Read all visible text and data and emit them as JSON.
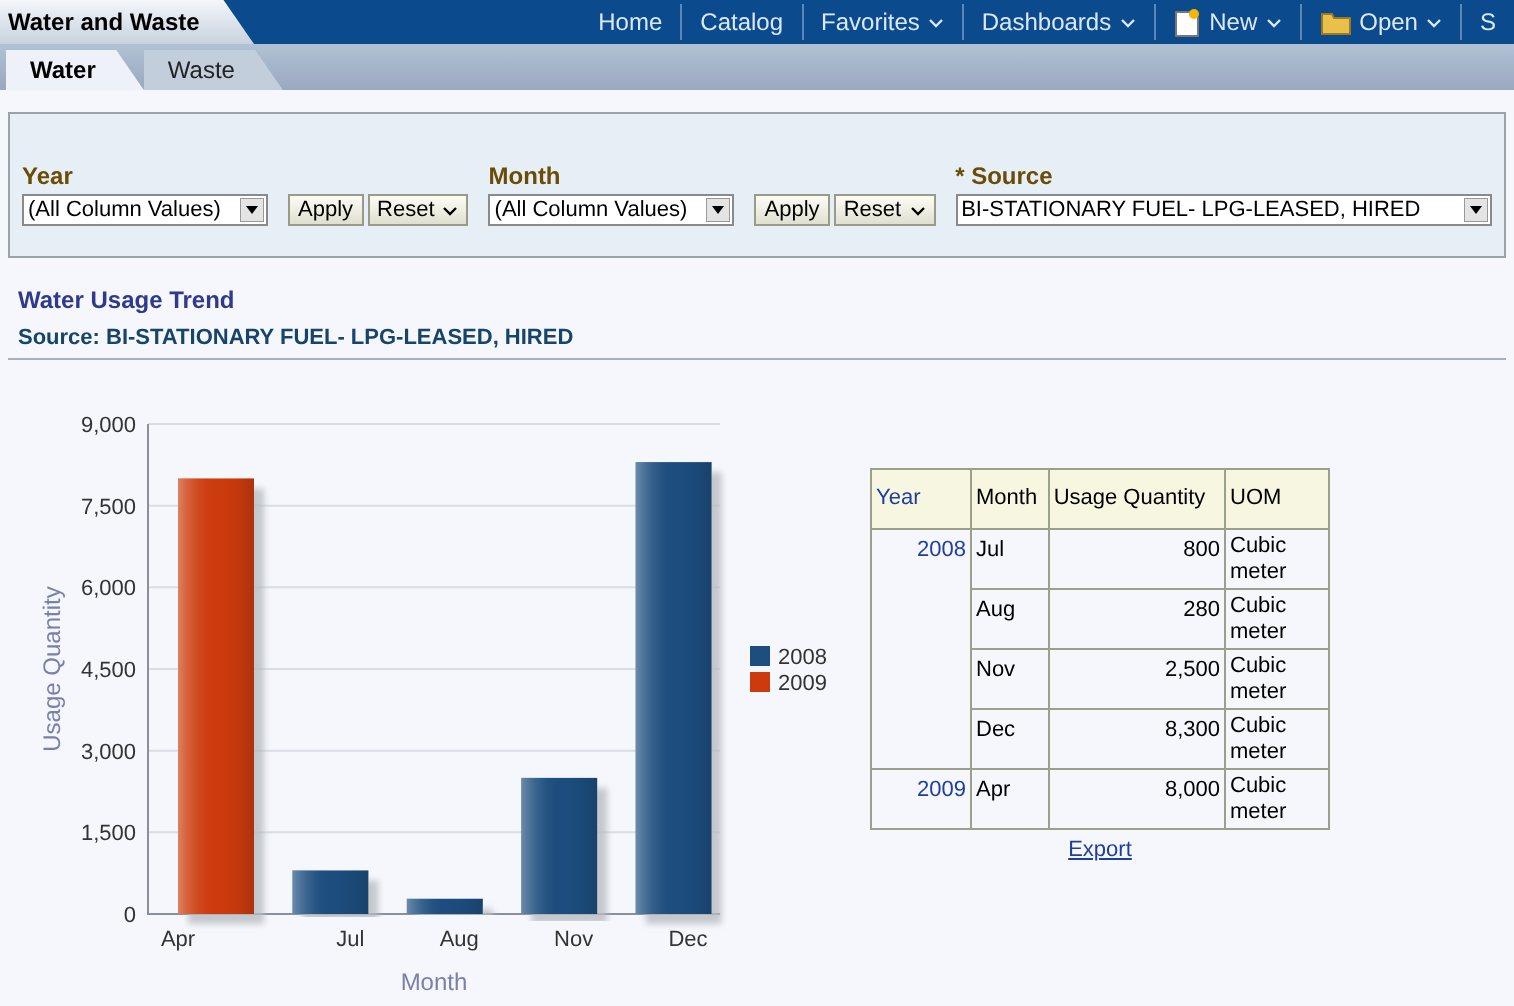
{
  "app_title": "Water and Waste",
  "nav": [
    {
      "label": "Home",
      "kind": "link"
    },
    {
      "label": "Catalog",
      "kind": "link"
    },
    {
      "label": "Favorites",
      "kind": "menu"
    },
    {
      "label": "Dashboards",
      "kind": "menu"
    },
    {
      "label": "New",
      "kind": "doc-menu"
    },
    {
      "label": "Open",
      "kind": "folder-menu"
    },
    {
      "label": "S",
      "kind": "link"
    }
  ],
  "tabs": [
    {
      "label": "Water",
      "selected": true
    },
    {
      "label": "Waste",
      "selected": false
    }
  ],
  "filters": [
    {
      "label": "Year",
      "value": "(All Column Values)",
      "buttons": [
        "Apply",
        "Reset"
      ]
    },
    {
      "label": "Month",
      "value": "(All Column Values)",
      "buttons": [
        "Apply",
        "Reset"
      ]
    },
    {
      "label": "* Source",
      "value": "BI-STATIONARY FUEL- LPG-LEASED, HIRED"
    }
  ],
  "report": {
    "title": "Water Usage Trend",
    "subtitle": "Source: BI-STATIONARY FUEL- LPG-LEASED, HIRED"
  },
  "chart_data": {
    "type": "bar",
    "xlabel": "Month",
    "ylabel": "Usage Quantity",
    "categories": [
      "Apr",
      "Jul",
      "Aug",
      "Nov",
      "Dec"
    ],
    "series": [
      {
        "name": "2008",
        "color": "#1f4e7e",
        "values": [
          null,
          800,
          280,
          2500,
          8300
        ]
      },
      {
        "name": "2009",
        "color": "#cc3a0e",
        "values": [
          8000,
          null,
          null,
          null,
          null
        ]
      }
    ],
    "grid": true,
    "legend": true,
    "ylim": [
      0,
      9000
    ],
    "yticks": [
      {
        "value": 0,
        "label": "0"
      },
      {
        "value": 1500,
        "label": "1,500"
      },
      {
        "value": 3000,
        "label": "3,000"
      },
      {
        "value": 4500,
        "label": "4,500"
      },
      {
        "value": 6000,
        "label": "6,000"
      },
      {
        "value": 7500,
        "label": "7,500"
      },
      {
        "value": 9000,
        "label": "9,000"
      }
    ]
  },
  "table": {
    "columns": [
      "Year",
      "Month",
      "Usage Quantity",
      "UOM"
    ],
    "groups": [
      {
        "year": "2008",
        "rows": [
          {
            "month": "Jul",
            "quantity": "800",
            "uom": "Cubic meter"
          },
          {
            "month": "Aug",
            "quantity": "280",
            "uom": "Cubic meter"
          },
          {
            "month": "Nov",
            "quantity": "2,500",
            "uom": "Cubic meter"
          },
          {
            "month": "Dec",
            "quantity": "8,300",
            "uom": "Cubic meter"
          }
        ]
      },
      {
        "year": "2009",
        "rows": [
          {
            "month": "Apr",
            "quantity": "8,000",
            "uom": "Cubic meter"
          }
        ]
      }
    ],
    "export_link": "Export"
  }
}
